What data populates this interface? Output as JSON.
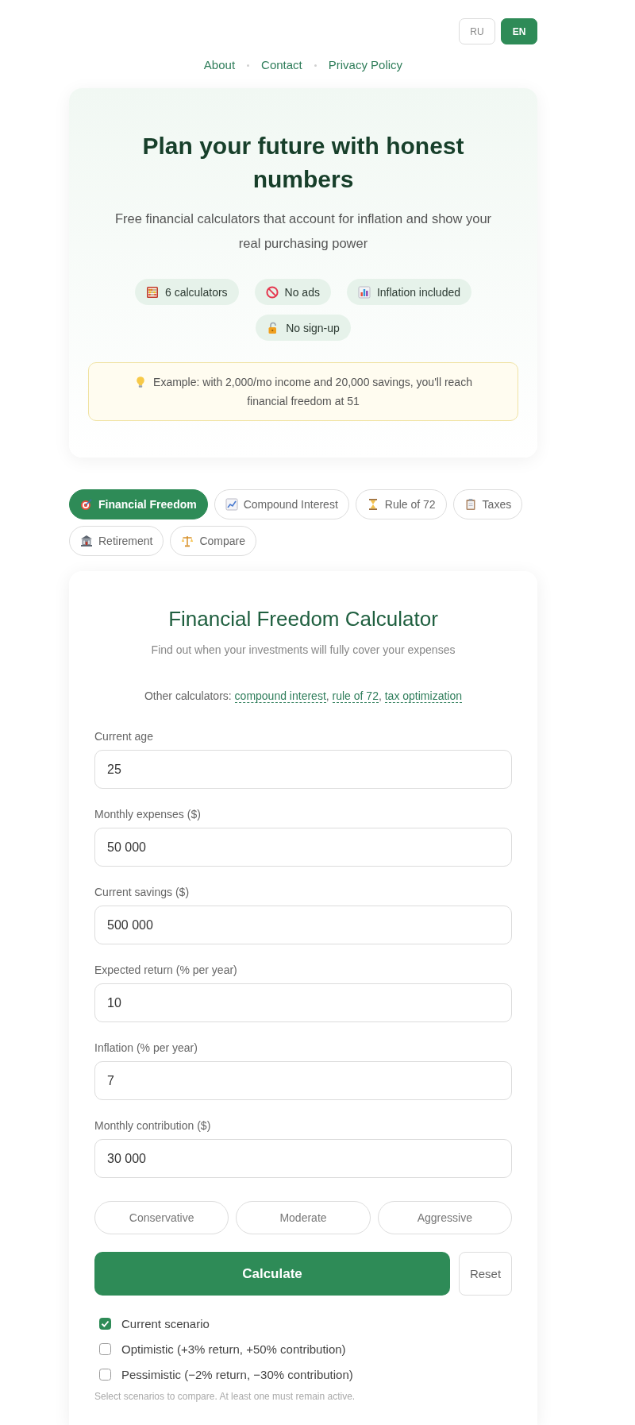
{
  "language_switch": [
    {
      "label": "RU",
      "selected": false
    },
    {
      "label": "EN",
      "selected": true
    }
  ],
  "nav": [
    "About",
    "Contact",
    "Privacy Policy"
  ],
  "hero": {
    "title": "Plan your future with honest numbers",
    "subtitle": "Free financial calculators that account for inflation and show your real purchasing power",
    "badges": [
      "6 calculators",
      "No ads",
      "Inflation included",
      "No sign-up"
    ],
    "example": "Example: with 2,000/mo income and 20,000 savings, you'll reach financial freedom at 51"
  },
  "tabs": [
    {
      "label": "Financial Freedom",
      "selected": true
    },
    {
      "label": "Compound Interest",
      "selected": false
    },
    {
      "label": "Rule of 72",
      "selected": false
    },
    {
      "label": "Taxes",
      "selected": false
    },
    {
      "label": "Retirement",
      "selected": false
    },
    {
      "label": "Compare",
      "selected": false
    }
  ],
  "calculator": {
    "title": "Financial Freedom Calculator",
    "subtitle": "Find out when your investments will fully cover your expenses",
    "other_calculators": {
      "label": "Other calculators:",
      "separator": ",",
      "links": [
        "compound interest",
        "rule of 72",
        "tax optimization"
      ]
    },
    "fields": [
      {
        "label": "Current age",
        "value": "25"
      },
      {
        "label": "Monthly expenses ($)",
        "value": "50 000"
      },
      {
        "label": "Current savings ($)",
        "value": "500 000"
      },
      {
        "label": "Expected return (% per year)",
        "value": "10"
      },
      {
        "label": "Inflation (% per year)",
        "value": "7"
      },
      {
        "label": "Monthly contribution ($)",
        "value": "30 000"
      }
    ],
    "presets": [
      {
        "label": "Conservative",
        "selected": false
      },
      {
        "label": "Moderate",
        "selected": false
      },
      {
        "label": "Aggressive",
        "selected": false
      }
    ],
    "calculate_button": "Calculate",
    "reset_button": "Reset",
    "scenarios": [
      {
        "label": "Current scenario",
        "checked": true
      },
      {
        "label": "Optimistic (+3% return, +50% contribution)",
        "checked": false
      },
      {
        "label": "Pessimistic (−2% return, −30% contribution)",
        "checked": false
      }
    ],
    "scenario_note": "Select scenarios to compare. At least one must remain active."
  }
}
